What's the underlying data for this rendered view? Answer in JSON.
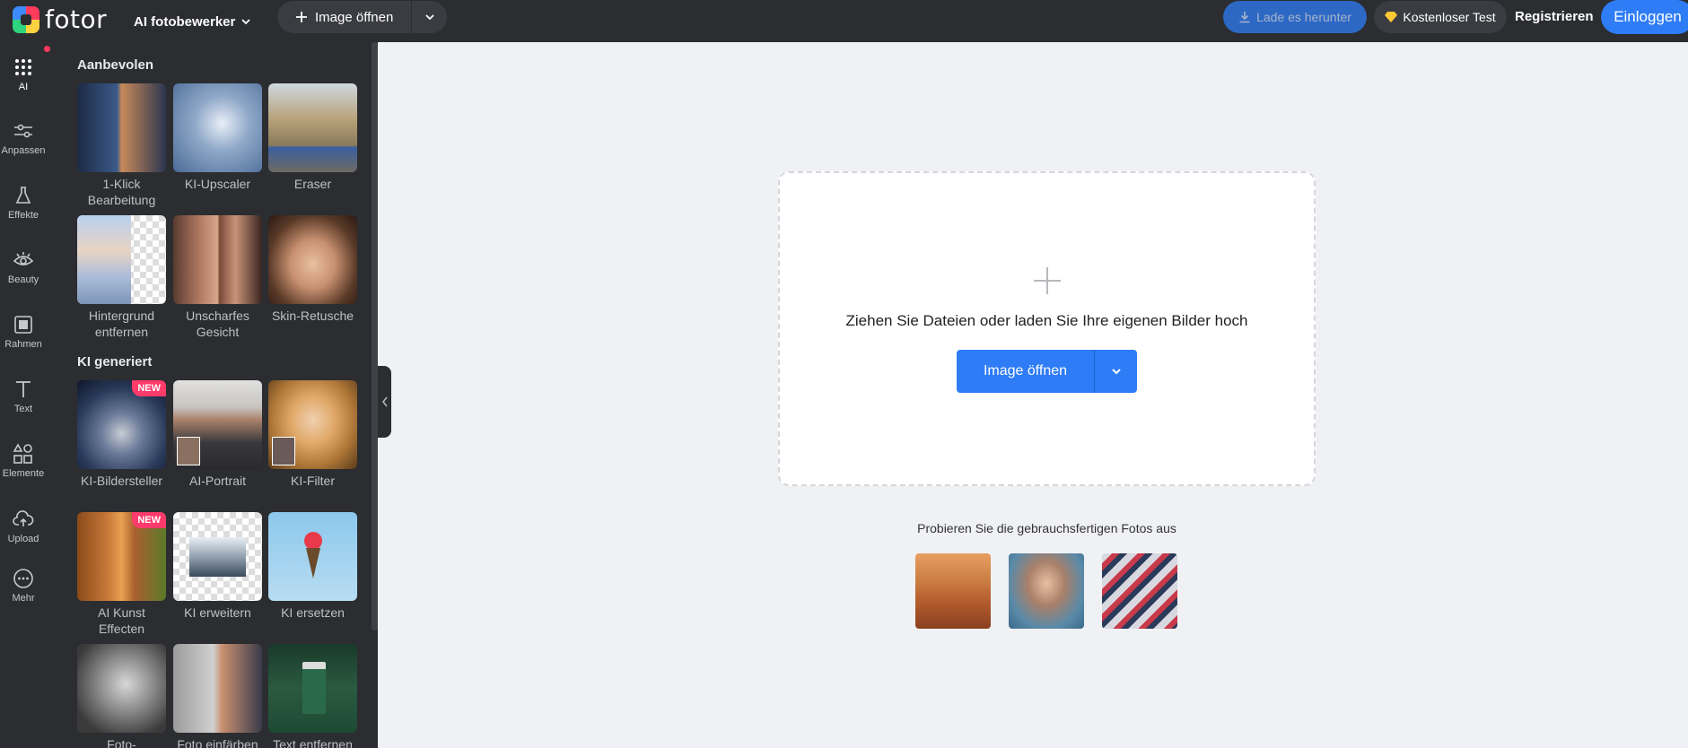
{
  "header": {
    "logo_text": "fotor",
    "menu_label": "AI fotobewerker",
    "open_label": "Image öffnen",
    "download_label": "Lade es herunter",
    "trial_label": "Kostenloser Test",
    "register_label": "Registrieren",
    "login_label": "Einloggen"
  },
  "rail": [
    {
      "label": "AI",
      "icon": "grid-dots-icon"
    },
    {
      "label": "Anpassen",
      "icon": "sliders-icon"
    },
    {
      "label": "Effekte",
      "icon": "flask-icon"
    },
    {
      "label": "Beauty",
      "icon": "eye-icon"
    },
    {
      "label": "Rahmen",
      "icon": "frame-icon"
    },
    {
      "label": "Text",
      "icon": "text-icon"
    },
    {
      "label": "Elemente",
      "icon": "shapes-icon"
    },
    {
      "label": "Upload",
      "icon": "cloud-upload-icon"
    },
    {
      "label": "Mehr",
      "icon": "more-icon"
    }
  ],
  "panel": {
    "section1": "Aanbevolen",
    "section2": "KI generiert",
    "tools": [
      {
        "label": "1-Klick Bearbeitung"
      },
      {
        "label": "KI-Upscaler"
      },
      {
        "label": "Eraser"
      },
      {
        "label": "Hintergrund entfernen"
      },
      {
        "label": "Unscharfes Gesicht"
      },
      {
        "label": "Skin-Retusche"
      },
      {
        "label": "KI-Bildersteller",
        "badge": "NEW"
      },
      {
        "label": "AI-Portrait"
      },
      {
        "label": "KI-Filter"
      },
      {
        "label": "AI Kunst Effecten",
        "badge": "NEW"
      },
      {
        "label": "KI erweitern"
      },
      {
        "label": "KI ersetzen"
      },
      {
        "label": "Foto-"
      },
      {
        "label": "Foto einfärben"
      },
      {
        "label": "Text entfernen"
      }
    ]
  },
  "main": {
    "drop_text": "Ziehen Sie Dateien oder laden Sie Ihre eigenen Bilder hoch",
    "open_label": "Image öffnen",
    "try_text": "Probieren Sie die gebrauchsfertigen Fotos aus"
  },
  "colors": {
    "accent": "#2e7cf6",
    "dark": "#2b2d31",
    "badge": "#ff3b6b"
  }
}
